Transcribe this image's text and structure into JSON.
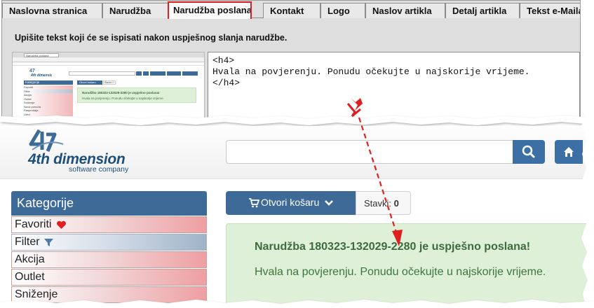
{
  "tabs": [
    {
      "label": "Naslovna stranica",
      "active": false
    },
    {
      "label": "Narudžba",
      "active": false
    },
    {
      "label": "Narudžba poslana",
      "active": true
    },
    {
      "label": "Kontakt",
      "active": false
    },
    {
      "label": "Logo",
      "active": false
    },
    {
      "label": "Naslov artikla",
      "active": false
    },
    {
      "label": "Detalj artikla",
      "active": false
    },
    {
      "label": "Tekst e-Maila",
      "active": false
    }
  ],
  "instruction": "Upišite tekst koji će se ispisati nakon uspješnog slanja narudžbe.",
  "editor": {
    "line1": "<h4>",
    "line2": "Hvala na povjerenju. Ponudu očekujte u najskorije vrijeme.",
    "line3": "</h4>"
  },
  "thumbnail": {
    "browser_tab": "Narudžba poslana",
    "categories_header": "Kategorije",
    "categories": [
      "Favoriti",
      "Filter",
      "Akcija",
      "Outlet",
      "Sniženje",
      "Nova ponuda",
      "Rasprodaja",
      "Ured"
    ],
    "cart_button": "Otvori košaru",
    "items_label": "Stavki: 0",
    "success_title": "Narudžba 180323-132029-2280 je uspješno poslana!",
    "success_msg": "Hvala na povjerenju. Ponudu očekujte u najskorije vrijeme."
  },
  "store": {
    "logo_text": "4th dimension",
    "logo_sub": "software company",
    "categories_header": "Kategorije",
    "categories": [
      {
        "label": "Favoriti",
        "style": "red",
        "icon": "heart-icon"
      },
      {
        "label": "Filter",
        "style": "blue",
        "icon": "filter-icon"
      },
      {
        "label": "Akcija",
        "style": "red"
      },
      {
        "label": "Outlet",
        "style": "red"
      },
      {
        "label": "Sniženje",
        "style": "red"
      }
    ],
    "cart_button": "Otvori košaru",
    "items_label": "Stavki:",
    "items_count": "0",
    "success_title": "Narudžba 180323-132029-2280 je uspješno poslana!",
    "success_msg": "Hvala na povjerenju. Ponudu očekujte u najskorije vrijeme."
  },
  "colors": {
    "brand_blue": "#3e6a98",
    "success_bg": "#dff0d8",
    "highlight_red": "#e02020"
  }
}
